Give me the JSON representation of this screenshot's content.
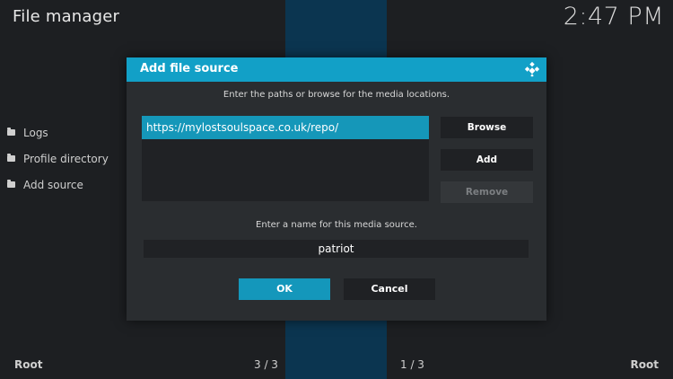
{
  "app": {
    "title": "File manager",
    "clock": "2:47 PM"
  },
  "sidebar": {
    "items": [
      {
        "label": "Logs",
        "icon": "folder-icon"
      },
      {
        "label": "Profile directory",
        "icon": "folder-icon"
      },
      {
        "label": "Add source",
        "icon": "folder-icon"
      }
    ]
  },
  "footer": {
    "left": "Root",
    "center_left": "3 / 3",
    "center_right": "1 / 3",
    "right": "Root"
  },
  "dialog": {
    "title": "Add file source",
    "icon": "kodi-logo-icon",
    "paths_hint": "Enter the paths or browse for the media locations.",
    "path_value": "https://mylostsoulspace.co.uk/repo/",
    "browse_label": "Browse",
    "add_label": "Add",
    "remove_label": "Remove",
    "name_hint": "Enter a name for this media source.",
    "name_value": "patriot",
    "ok_label": "OK",
    "cancel_label": "Cancel"
  },
  "colors": {
    "accent": "#12a0c7",
    "background": "#1b1d20",
    "dialog_bg": "#2a2d30",
    "center_band": "#0b3550"
  }
}
